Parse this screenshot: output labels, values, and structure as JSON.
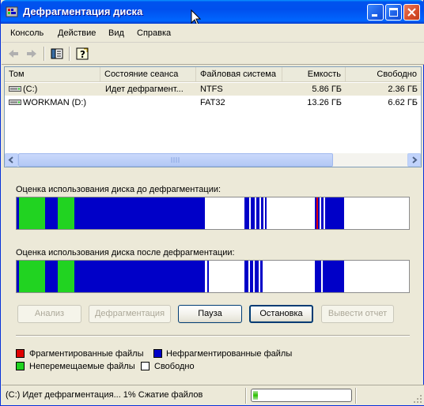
{
  "window": {
    "title": "Дефрагментация диска"
  },
  "menu": {
    "items": [
      "Консоль",
      "Действие",
      "Вид",
      "Справка"
    ]
  },
  "toolbar": {
    "icons": [
      "back-arrow-icon",
      "forward-arrow-icon",
      "show-hide-console-tree-icon",
      "help-icon"
    ]
  },
  "volumes": {
    "columns": [
      "Том",
      "Состояние сеанса",
      "Файловая система",
      "Емкость",
      "Свободно"
    ],
    "rows": [
      {
        "volume": "(C:)",
        "status": "Идет дефрагмент...",
        "fs": "NTFS",
        "capacity": "5.86 ГБ",
        "free": "2.36 ГБ"
      },
      {
        "volume": "WORKMAN (D:)",
        "status": "",
        "fs": "FAT32",
        "capacity": "13.26 ГБ",
        "free": "6.62 ГБ"
      }
    ]
  },
  "analysis": {
    "before_label": "Оценка использования диска до дефрагментации:",
    "after_label": "Оценка использования диска после дефрагментации:"
  },
  "buttons": {
    "analyze": "Анализ",
    "defragment": "Дефрагментация",
    "pause": "Пауза",
    "stop": "Остановка",
    "report": "Вывести отчет"
  },
  "legend": {
    "fragmented": "Фрагментированные файлы",
    "contiguous": "Нефрагментированные файлы",
    "unmovable": "Неперемещаемые файлы",
    "free": "Свободно"
  },
  "colors": {
    "fragmented": "#e00000",
    "contiguous": "#0000c8",
    "unmovable": "#21d321",
    "free": "#ffffff"
  },
  "status": {
    "text": "(C:) Идет дефрагментация... 1%  Сжатие файлов",
    "progress": 0.05
  }
}
